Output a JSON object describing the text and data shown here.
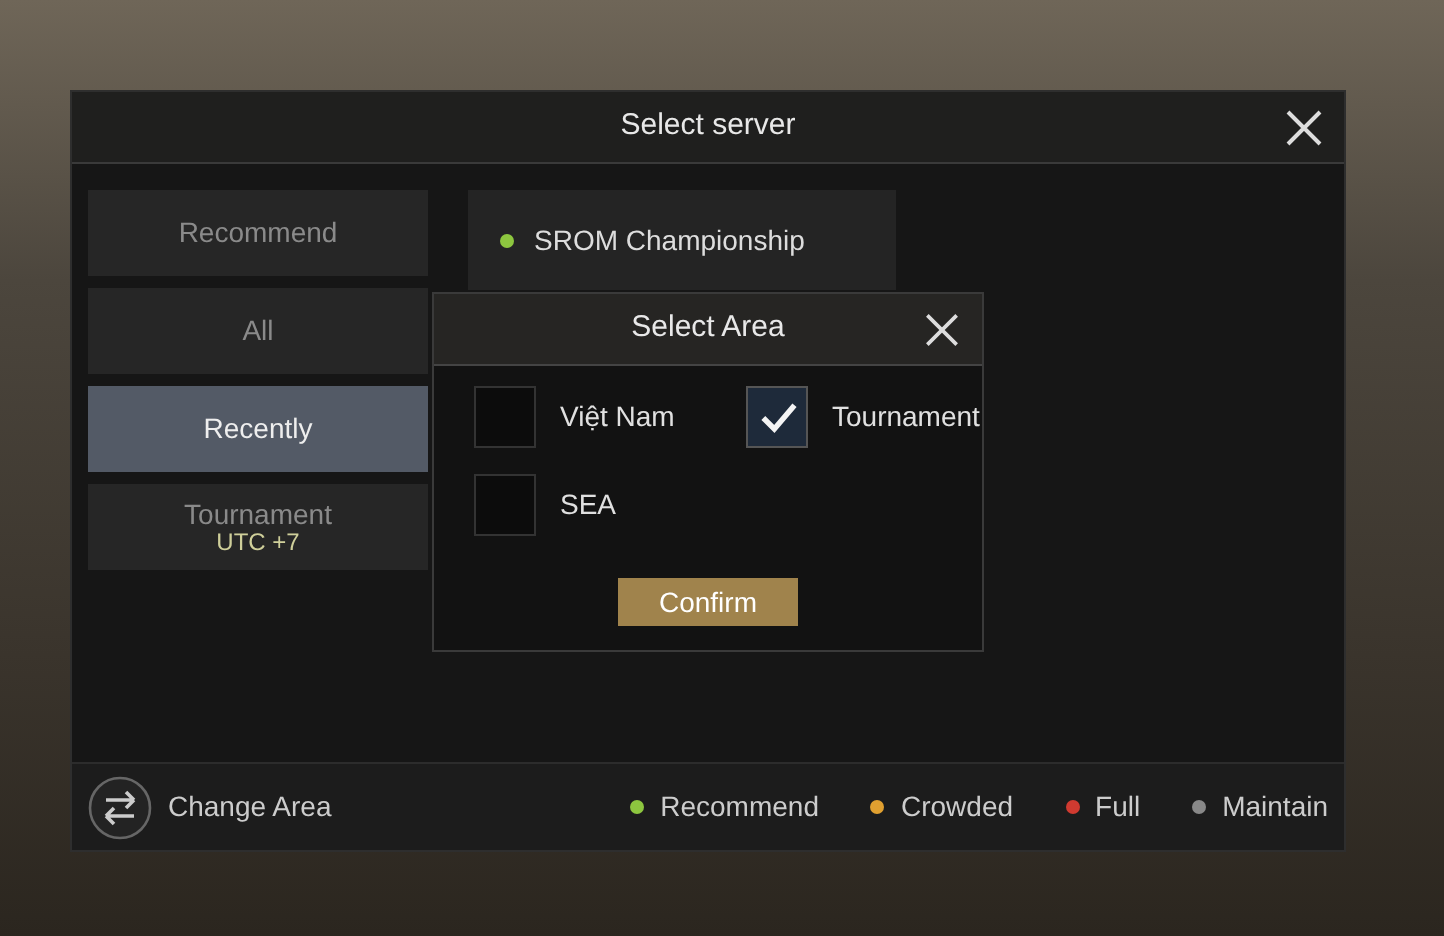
{
  "dialog": {
    "title": "Select server"
  },
  "tabs": [
    {
      "label": "Recommend",
      "selected": false
    },
    {
      "label": "All",
      "selected": false
    },
    {
      "label": "Recently",
      "selected": true
    },
    {
      "label": "Tournament",
      "sublabel": "UTC +7",
      "selected": false
    }
  ],
  "servers": [
    {
      "name": "SROM Championship",
      "color": "#8dc63f"
    }
  ],
  "area_dialog": {
    "title": "Select Area",
    "options": [
      {
        "label": "Việt Nam",
        "checked": false
      },
      {
        "label": "Tournament",
        "checked": true
      },
      {
        "label": "SEA",
        "checked": false
      }
    ],
    "confirm": "Confirm"
  },
  "footer": {
    "change_area": "Change Area",
    "legend": [
      {
        "label": "Recommend",
        "color": "#8dc63f"
      },
      {
        "label": "Crowded",
        "color": "#e0a030"
      },
      {
        "label": "Full",
        "color": "#d03a30"
      },
      {
        "label": "Maintain",
        "color": "#888888"
      }
    ]
  }
}
